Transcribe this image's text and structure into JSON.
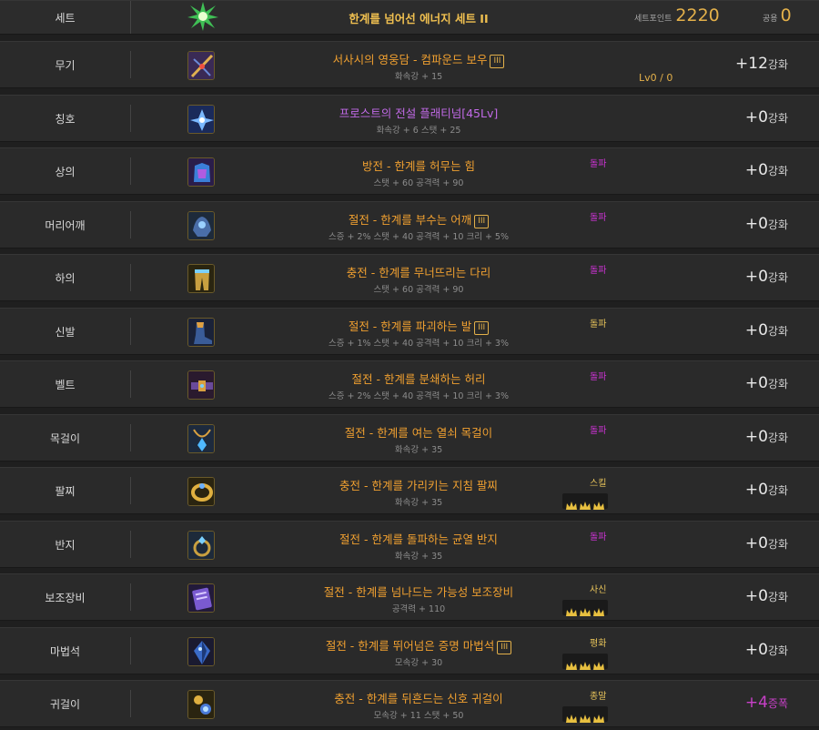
{
  "colors": {
    "epic": "#f0a030",
    "legendary": "#c26ae8",
    "pink": "#d033d8",
    "gold": "#e3b04a"
  },
  "set": {
    "slot": "세트",
    "icon": "sparkle-icon",
    "name": "한계를 넘어선 에너지 세트 II",
    "setpoint_label": "세트포인트",
    "setpoint_value": "2220",
    "common_label": "공용",
    "common_value": "0"
  },
  "items": [
    {
      "slot": "무기",
      "icon": "weapon-icon",
      "name": "서사시의 영웅담 - 컴파운드 보우",
      "tier": "III",
      "name_color": "#f0a030",
      "stats": "화속강 + 15",
      "tag": "",
      "tag_color": "",
      "crowns": 0,
      "lv": "Lv0 / 0",
      "enh_value": "+12",
      "enh_unit": "강화",
      "enh_color": ""
    },
    {
      "slot": "칭호",
      "icon": "title-icon",
      "name": "프로스트의 전설 플래티넘[45Lv]",
      "tier": "",
      "name_color": "#c26ae8",
      "stats": "화속강 + 6 스탯 + 25",
      "tag": "",
      "tag_color": "",
      "crowns": 0,
      "lv": "",
      "enh_value": "+0",
      "enh_unit": "강화",
      "enh_color": ""
    },
    {
      "slot": "상의",
      "icon": "top-armor-icon",
      "name": "방전 - 한계를 허무는 힘",
      "tier": "",
      "name_color": "#f0a030",
      "stats": "스탯 + 60 공격력 + 90",
      "tag": "돌파",
      "tag_color": "pink",
      "crowns": 0,
      "lv": "",
      "enh_value": "+0",
      "enh_unit": "강화",
      "enh_color": ""
    },
    {
      "slot": "머리어깨",
      "icon": "shoulder-armor-icon",
      "name": "절전 - 한계를 부수는 어깨",
      "tier": "III",
      "name_color": "#f0a030",
      "stats": "스증 + 2% 스탯 + 40 공격력 + 10 크리 + 5%",
      "tag": "돌파",
      "tag_color": "pink",
      "crowns": 0,
      "lv": "",
      "enh_value": "+0",
      "enh_unit": "강화",
      "enh_color": ""
    },
    {
      "slot": "하의",
      "icon": "bottom-armor-icon",
      "name": "충전 - 한계를 무너뜨리는 다리",
      "tier": "",
      "name_color": "#f0a030",
      "stats": "스탯 + 60 공격력 + 90",
      "tag": "돌파",
      "tag_color": "pink",
      "crowns": 0,
      "lv": "",
      "enh_value": "+0",
      "enh_unit": "강화",
      "enh_color": ""
    },
    {
      "slot": "신발",
      "icon": "shoes-icon",
      "name": "절전 - 한계를 파괴하는 발",
      "tier": "III",
      "name_color": "#f0a030",
      "stats": "스증 + 1% 스탯 + 40 공격력 + 10 크리 + 3%",
      "tag": "돌파",
      "tag_color": "gold",
      "crowns": 0,
      "lv": "",
      "enh_value": "+0",
      "enh_unit": "강화",
      "enh_color": ""
    },
    {
      "slot": "벨트",
      "icon": "belt-icon",
      "name": "절전 - 한계를 분쇄하는 허리",
      "tier": "",
      "name_color": "#f0a030",
      "stats": "스증 + 2% 스탯 + 40 공격력 + 10 크리 + 3%",
      "tag": "돌파",
      "tag_color": "pink",
      "crowns": 0,
      "lv": "",
      "enh_value": "+0",
      "enh_unit": "강화",
      "enh_color": ""
    },
    {
      "slot": "목걸이",
      "icon": "necklace-icon",
      "name": "절전 - 한계를 여는 열쇠 목걸이",
      "tier": "",
      "name_color": "#f0a030",
      "stats": "화속강 + 35",
      "tag": "돌파",
      "tag_color": "pink",
      "crowns": 0,
      "lv": "",
      "enh_value": "+0",
      "enh_unit": "강화",
      "enh_color": ""
    },
    {
      "slot": "팔찌",
      "icon": "bracelet-icon",
      "name": "충전 - 한계를 가리키는 지침 팔찌",
      "tier": "",
      "name_color": "#f0a030",
      "stats": "화속강 + 35",
      "tag": "스킬",
      "tag_color": "gold",
      "crowns": 3,
      "lv": "",
      "enh_value": "+0",
      "enh_unit": "강화",
      "enh_color": ""
    },
    {
      "slot": "반지",
      "icon": "ring-icon",
      "name": "절전 - 한계를 돌파하는 균열 반지",
      "tier": "",
      "name_color": "#f0a030",
      "stats": "화속강 + 35",
      "tag": "돌파",
      "tag_color": "pink",
      "crowns": 0,
      "lv": "",
      "enh_value": "+0",
      "enh_unit": "강화",
      "enh_color": ""
    },
    {
      "slot": "보조장비",
      "icon": "sub-equipment-icon",
      "name": "절전 - 한계를 넘나드는 가능성 보조장비",
      "tier": "",
      "name_color": "#f0a030",
      "stats": "공격력 + 110",
      "tag": "사신",
      "tag_color": "gold",
      "crowns": 3,
      "lv": "",
      "enh_value": "+0",
      "enh_unit": "강화",
      "enh_color": ""
    },
    {
      "slot": "마법석",
      "icon": "magic-stone-icon",
      "name": "절전 - 한계를 뛰어넘은 증명 마법석",
      "tier": "III",
      "name_color": "#f0a030",
      "stats": "모속강 + 30",
      "tag": "평화",
      "tag_color": "gold",
      "crowns": 3,
      "lv": "",
      "enh_value": "+0",
      "enh_unit": "강화",
      "enh_color": ""
    },
    {
      "slot": "귀걸이",
      "icon": "earring-icon",
      "name": "충전 - 한계를 뒤흔드는 신호 귀걸이",
      "tier": "",
      "name_color": "#f0a030",
      "stats": "모속강 + 11 스탯 + 50",
      "tag": "종말",
      "tag_color": "gold",
      "crowns": 3,
      "lv": "",
      "enh_value": "+4",
      "enh_unit": "증폭",
      "enh_color": "pink"
    }
  ]
}
